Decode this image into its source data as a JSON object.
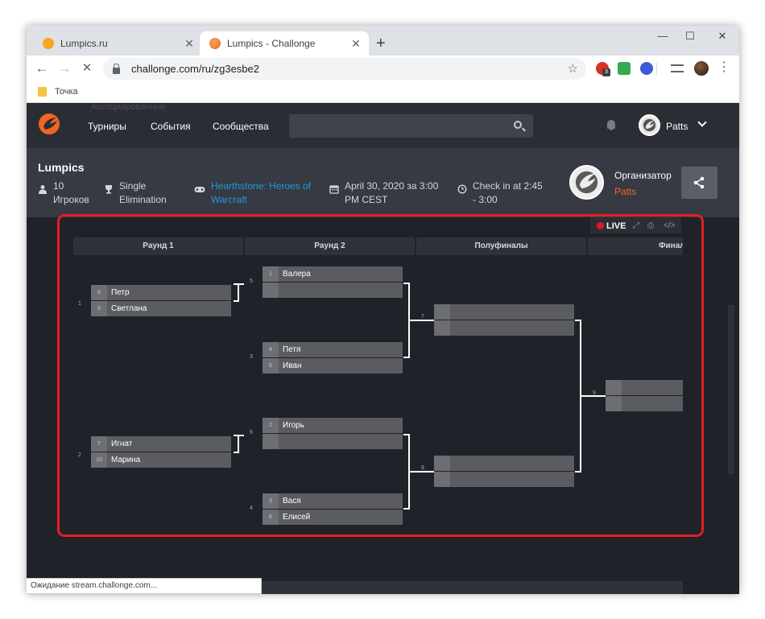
{
  "browser": {
    "tabs": [
      {
        "title": "Lumpics.ru",
        "favicon_color": "#f5a623",
        "close": "✕"
      },
      {
        "title": "Lumpics - Challonge",
        "favicon_color": "#f26522",
        "close": "✕"
      }
    ],
    "new_tab": "+",
    "window_controls": {
      "minimize": "—",
      "maximize": "☐",
      "close": "✕"
    },
    "nav": {
      "back": "←",
      "forward": "→",
      "reload": "✕"
    },
    "url": "challonge.com/ru/zg3esbe2",
    "star": "☆",
    "extension_badge": "3",
    "menu": "⋮",
    "bookmark": "Точка",
    "status": "Ожидание stream.challonge.com..."
  },
  "site": {
    "ghost_text": "Ассоциированные",
    "nav": [
      "Турниры",
      "События",
      "Сообщества"
    ],
    "user": "Patts",
    "accent": "#f26522"
  },
  "tournament": {
    "name": "Lumpics",
    "players_count": "10",
    "players_label": "Игроков",
    "format_line1": "Single",
    "format_line2": "Elimination",
    "game_line1": "Hearthstone: Heroes of",
    "game_line2": "Warcraft",
    "date_line1": "April 30, 2020 за 3:00",
    "date_line2": "PM CEST",
    "checkin_line1": "Check in at 2:45",
    "checkin_line2": "- 3:00",
    "organizer_label": "Организатор",
    "organizer_name": "Patts"
  },
  "bracket": {
    "live": "LIVE",
    "tools": {
      "fullscreen": "⤢",
      "print": "⎙",
      "embed": "</>"
    },
    "rounds": [
      "Раунд 1",
      "Раунд 2",
      "Полуфиналы",
      "Финал"
    ],
    "matches": [
      {
        "id": "1",
        "p1": {
          "seed": "8",
          "name": "Петр"
        },
        "p2": {
          "seed": "9",
          "name": "Светлана"
        }
      },
      {
        "id": "2",
        "p1": {
          "seed": "7",
          "name": "Игнат"
        },
        "p2": {
          "seed": "10",
          "name": "Марина"
        }
      },
      {
        "id": "5",
        "p1": {
          "seed": "1",
          "name": "Валера"
        },
        "p2": {
          "seed": "",
          "name": ""
        }
      },
      {
        "id": "3",
        "p1": {
          "seed": "4",
          "name": "Петя"
        },
        "p2": {
          "seed": "5",
          "name": "Иван"
        }
      },
      {
        "id": "6",
        "p1": {
          "seed": "2",
          "name": "Игорь"
        },
        "p2": {
          "seed": "",
          "name": ""
        }
      },
      {
        "id": "4",
        "p1": {
          "seed": "3",
          "name": "Вася"
        },
        "p2": {
          "seed": "6",
          "name": "Елисей"
        }
      },
      {
        "id": "7",
        "p1": {
          "seed": "",
          "name": ""
        },
        "p2": {
          "seed": "",
          "name": ""
        }
      },
      {
        "id": "8",
        "p1": {
          "seed": "",
          "name": ""
        },
        "p2": {
          "seed": "",
          "name": ""
        }
      },
      {
        "id": "9",
        "p1": {
          "seed": "",
          "name": ""
        },
        "p2": {
          "seed": "",
          "name": ""
        }
      }
    ]
  }
}
